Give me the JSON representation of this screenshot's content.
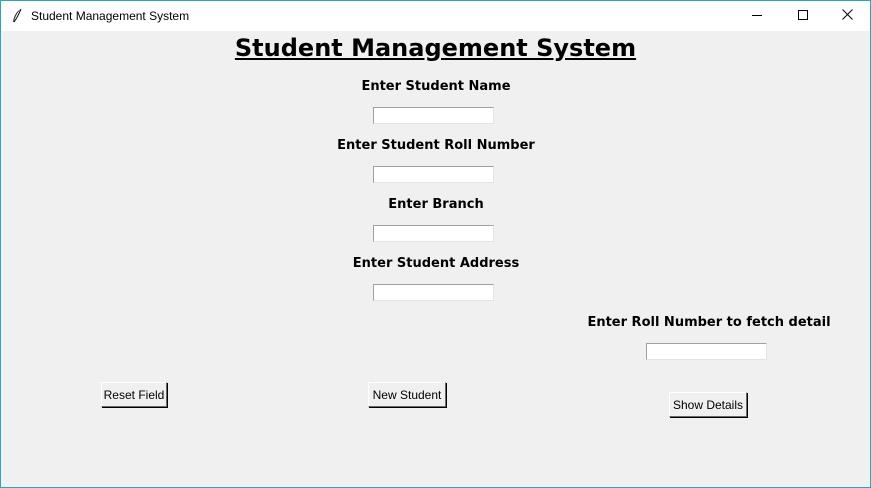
{
  "window": {
    "title": "Student Management System",
    "controls": {
      "minimize": "minimize-icon",
      "maximize": "maximize-icon",
      "close": "close-icon"
    }
  },
  "form": {
    "heading": "Student Management System",
    "fields": [
      {
        "label": "Enter Student Name",
        "value": ""
      },
      {
        "label": "Enter Student Roll Number",
        "value": ""
      },
      {
        "label": "Enter Branch",
        "value": ""
      },
      {
        "label": "Enter Student Address",
        "value": ""
      }
    ]
  },
  "fetch": {
    "label": "Enter Roll Number to fetch detail",
    "value": ""
  },
  "buttons": {
    "reset": "Reset Field",
    "new_student": "New Student",
    "show_details": "Show Details"
  },
  "colors": {
    "window_bg": "#f0f0f0",
    "titlebar_bg": "#ffffff",
    "window_border": "#2aa8b8"
  }
}
